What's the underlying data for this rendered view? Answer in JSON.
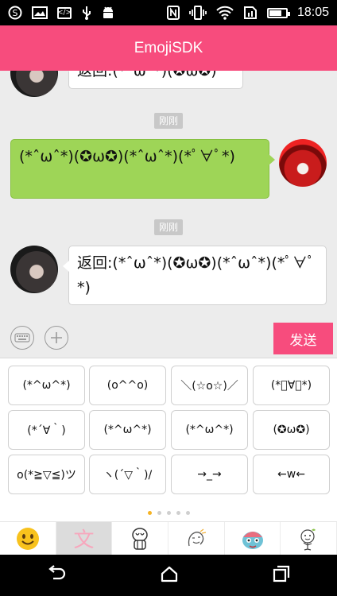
{
  "status_bar": {
    "time": "18:05",
    "left_icons": [
      "s-circle-icon",
      "image-icon",
      "code-icon",
      "usb-icon",
      "android-icon"
    ],
    "right_icons": [
      "nfc-icon",
      "vibrate-icon",
      "wifi-icon",
      "sim-icon",
      "battery-icon"
    ]
  },
  "app_bar": {
    "title": "EmojiSDK"
  },
  "chat": {
    "messages": [
      {
        "side": "left",
        "text": "返回:(*ˆωˆ*)(✪ω✪)",
        "avatar": "avatar-dark"
      },
      {
        "timestamp": "刚刚"
      },
      {
        "side": "right",
        "text": "(*ˆωˆ*)(✪ω✪)(*ˆωˆ*)(*ﾟ∀ﾟ*)",
        "avatar": "avatar-red"
      },
      {
        "timestamp": "刚刚"
      },
      {
        "side": "left",
        "text": "返回:(*ˆωˆ*)(✪ω✪)(*ˆωˆ*)(*ﾟ∀ﾟ*)",
        "avatar": "avatar-dark"
      }
    ]
  },
  "input_bar": {
    "keyboard_icon": "keyboard-icon",
    "add_icon": "plus-icon",
    "send_label": "发送"
  },
  "emoji_keys": [
    "(*^ω^*)",
    "(o^^o)",
    "＼(☆o☆)／",
    "(*ﾟ∀ﾟ*)",
    "(*´∀｀)",
    "(*^ω^*)",
    "(*^ω^*)",
    "(✪ω✪)",
    "o(*≧▽≦)ツ",
    "ヽ(´▽｀)/",
    "→_→",
    "←w←"
  ],
  "page_indicator": {
    "count": 5,
    "active": 0
  },
  "categories": [
    {
      "name": "emoji-face-icon",
      "selected": false
    },
    {
      "name": "text-emoticon-icon",
      "label": "文",
      "selected": true
    },
    {
      "name": "sticker-1-icon",
      "selected": false
    },
    {
      "name": "sticker-2-icon",
      "selected": false
    },
    {
      "name": "sticker-3-icon",
      "selected": false
    },
    {
      "name": "sticker-4-icon",
      "selected": false
    }
  ],
  "colors": {
    "accent": "#f74c7d",
    "outgoing_bubble": "#9ed557",
    "incoming_bubble": "#ffffff",
    "active_dot": "#f5b324"
  },
  "nav_bar": {
    "icons": [
      "back-icon",
      "home-icon",
      "recents-icon"
    ]
  }
}
